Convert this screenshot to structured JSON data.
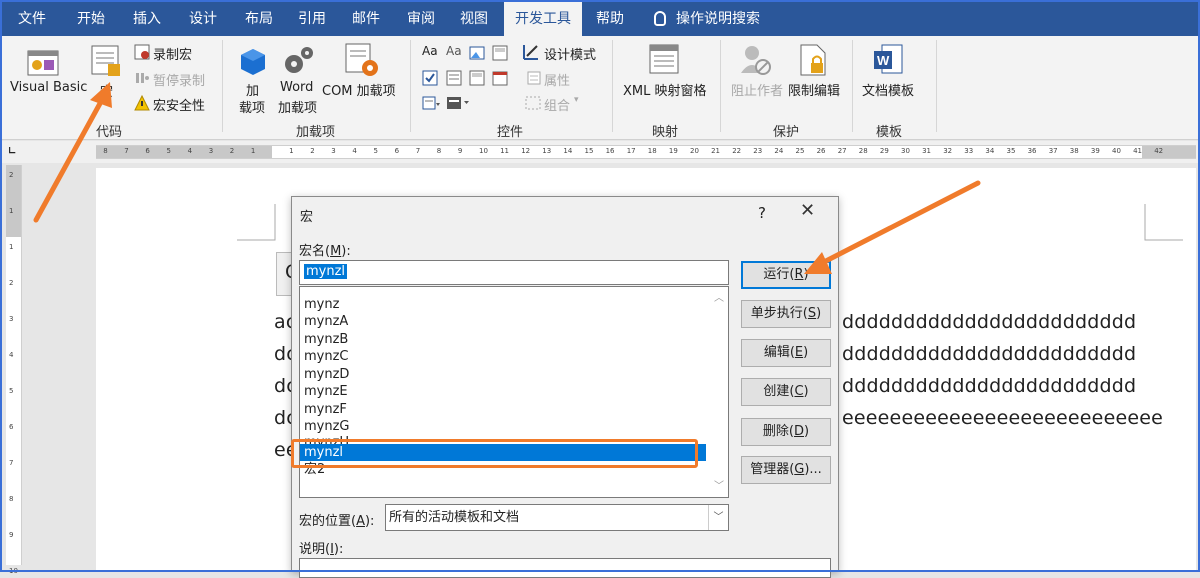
{
  "ribbon": {
    "tabs": [
      "文件",
      "开始",
      "插入",
      "设计",
      "布局",
      "引用",
      "邮件",
      "审阅",
      "视图",
      "开发工具",
      "帮助"
    ],
    "active_tab": "开发工具",
    "search_label": "操作说明搜索",
    "groups": {
      "code": {
        "label": "代码",
        "visual_basic": "Visual Basic",
        "macros": "宏",
        "record_macro": "录制宏",
        "pause_recording": "暂停录制",
        "macro_security": "宏安全性"
      },
      "addins": {
        "label": "加载项",
        "addins": "加\n载项",
        "addins_line1": "加",
        "addins_line2": "载项",
        "word_addins_line1": "Word",
        "word_addins_line2": "加载项",
        "com_addins": "COM 加载项"
      },
      "controls": {
        "label": "控件",
        "design_mode": "设计模式",
        "properties": "属性",
        "group": "组合"
      },
      "mapping": {
        "label": "映射",
        "xml_pane": "XML 映射窗格"
      },
      "protect": {
        "label": "保护",
        "block_authors": "阻止作者",
        "restrict_editing": "限制编辑"
      },
      "templates": {
        "label": "模板",
        "document_template": "文档模板"
      }
    }
  },
  "ruler": {
    "left_marks": [
      "8",
      "7",
      "6",
      "5",
      "4",
      "3",
      "2",
      "1"
    ],
    "right_marks": [
      "1",
      "2",
      "3",
      "4",
      "5",
      "6",
      "7",
      "8",
      "9",
      "10",
      "11",
      "12",
      "13",
      "14",
      "15",
      "16",
      "17",
      "18",
      "19",
      "20",
      "21",
      "22",
      "23",
      "24",
      "25",
      "26",
      "27",
      "28",
      "29",
      "30",
      "31",
      "32",
      "33",
      "34",
      "35",
      "36",
      "37",
      "38",
      "39",
      "40",
      "41",
      "42"
    ],
    "vertical_marks": [
      "2",
      "1",
      "1",
      "2",
      "3",
      "4",
      "5",
      "6",
      "7",
      "8",
      "9",
      "10"
    ]
  },
  "document": {
    "left_lines": [
      "ac",
      "dc",
      "dc",
      "dc",
      "ee"
    ],
    "right_lines": [
      "dddddddddddddddddddddddd",
      "dddddddddddddddddddddddd",
      "dddddddddddddddddddddddd",
      "eeeeeeeeeeeeeeeeeeeeeeeeeee"
    ],
    "fragment": "C"
  },
  "dialog": {
    "title": "宏",
    "help": "?",
    "close": "✕",
    "name_label": "宏名(M):",
    "name_label_pre": "宏名(",
    "name_label_key": "M",
    "name_label_post": "):",
    "name_value": "mynzl",
    "macros": [
      "mynz",
      "mynzA",
      "mynzB",
      "mynzC",
      "mynzD",
      "mynzE",
      "mynzF",
      "mynzG",
      "mynzH",
      "mynzl",
      "宏2"
    ],
    "selected_macro": "mynzl",
    "buttons": [
      {
        "pre": "运行(",
        "key": "R",
        "post": ")"
      },
      {
        "pre": "单步执行(",
        "key": "S",
        "post": ")"
      },
      {
        "pre": "编辑(",
        "key": "E",
        "post": ")"
      },
      {
        "pre": "创建(",
        "key": "C",
        "post": ")"
      },
      {
        "pre": "删除(",
        "key": "D",
        "post": ")"
      },
      {
        "pre": "管理器(",
        "key": "G",
        "post": ")..."
      }
    ],
    "location_label_pre": "宏的位置(",
    "location_label_key": "A",
    "location_label_post": "):",
    "location_value": "所有的活动模板和文档",
    "description_label_pre": "说明(",
    "description_label_key": "I",
    "description_label_post": "):"
  },
  "colors": {
    "ribbon_blue": "#2b579a",
    "selection_blue": "#0078d7",
    "annotation_orange": "#f07b2b"
  }
}
